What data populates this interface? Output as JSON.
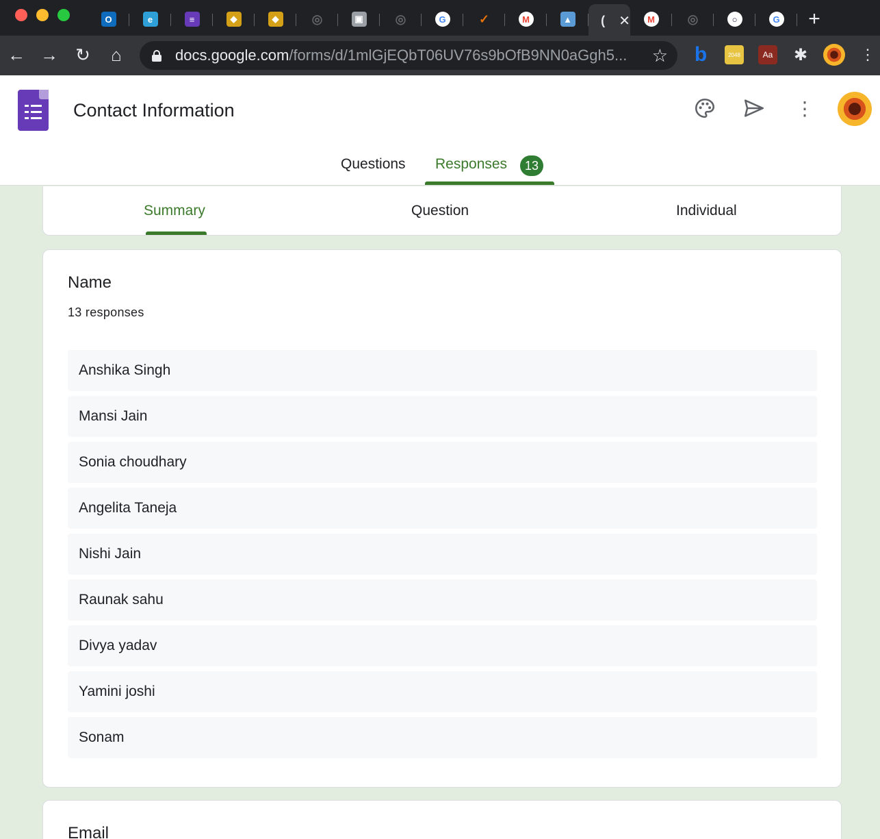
{
  "browser": {
    "tabs": [
      {
        "icon": "outlook-icon",
        "color": "#0f6cbd",
        "glyph": "O"
      },
      {
        "icon": "edge-icon",
        "color": "#2f9fd8",
        "glyph": "e"
      },
      {
        "icon": "forms-icon",
        "color": "#673ab7",
        "glyph": "≡"
      },
      {
        "icon": "shield-icon",
        "color": "#d4a017",
        "glyph": "◆"
      },
      {
        "icon": "shield-icon",
        "color": "#d4a017",
        "glyph": "◆"
      },
      {
        "icon": "globe-icon",
        "color": "#5f6368",
        "glyph": "◎"
      },
      {
        "icon": "slides-icon",
        "color": "#9aa0a6",
        "glyph": "▣"
      },
      {
        "icon": "globe-icon",
        "color": "#5f6368",
        "glyph": "◎"
      },
      {
        "icon": "google-icon",
        "color": "#ffffff",
        "glyph": "G"
      },
      {
        "icon": "checkmark-icon",
        "color": "#e8710a",
        "glyph": "✓"
      },
      {
        "icon": "gmail-icon",
        "color": "#ffffff",
        "glyph": "M"
      },
      {
        "icon": "image-icon",
        "color": "#5b9bd5",
        "glyph": "▲"
      },
      {
        "icon": "loading-icon",
        "color": "#e8eaed",
        "glyph": "(",
        "active": true
      },
      {
        "icon": "gmail-icon",
        "color": "#ffffff",
        "glyph": "M"
      },
      {
        "icon": "globe-icon",
        "color": "#5f6368",
        "glyph": "◎"
      },
      {
        "icon": "ring-icon",
        "color": "#1a1a40",
        "glyph": "○"
      },
      {
        "icon": "google-icon",
        "color": "#ffffff",
        "glyph": "G"
      }
    ],
    "url_host": "docs.google.com",
    "url_path": "/forms/d/1mlGjEQbT06UV76s9bOfB9NN0aGgh5..."
  },
  "form": {
    "title": "Contact Information",
    "tabs": {
      "questions": "Questions",
      "responses": "Responses",
      "responses_count": "13"
    },
    "subtabs": {
      "summary": "Summary",
      "question": "Question",
      "individual": "Individual"
    }
  },
  "questions": [
    {
      "title": "Name",
      "count_label": "13 responses",
      "responses": [
        "Anshika Singh",
        "Mansi Jain",
        "Sonia choudhary",
        "Angelita Taneja",
        "Nishi Jain",
        "Raunak sahu",
        "Divya yadav",
        "Yamini joshi",
        "Sonam"
      ]
    },
    {
      "title": "Email"
    }
  ],
  "colors": {
    "accent": "#3b7a2b",
    "badge": "#2e7d32",
    "page_bg": "#e2ede0",
    "forms_purple": "#673ab7"
  }
}
